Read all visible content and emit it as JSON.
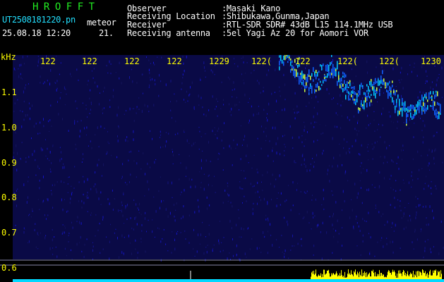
{
  "header": {
    "brand": "HROFFT",
    "filename": "UT2508181220.pn",
    "meteor_word": "meteor",
    "datetime": "25.08.18 12:20",
    "count": "21.",
    "info": [
      {
        "label": "Observer",
        "value": ":Masaki Kano"
      },
      {
        "label": "Receiving Location",
        "value": ":Shibukawa,Gunma,Japan"
      },
      {
        "label": "Receiver",
        "value": ":RTL-SDR SDR# 43dB L15 114.1MHz USB"
      },
      {
        "label": "Receiving antenna",
        "value": ":5el Yagi Az 20 for Aomori VOR"
      }
    ]
  },
  "axes": {
    "unit": "kHz",
    "y_ticks": [
      "1.1",
      "1.0",
      "0.9",
      "0.8",
      "0.7",
      "0.6"
    ],
    "x_ticks": [
      "122",
      "122",
      "122",
      "122",
      "1229",
      "122(",
      "122",
      "122(",
      "122(",
      "1230"
    ]
  },
  "colors": {
    "background": "#000000",
    "noise": "#0c0c50",
    "axis_text": "#ffff00",
    "trace": "#00d0ff",
    "power_bars": "#ffff00",
    "brand": "#22ee22",
    "filename": "#22e0ff"
  }
}
